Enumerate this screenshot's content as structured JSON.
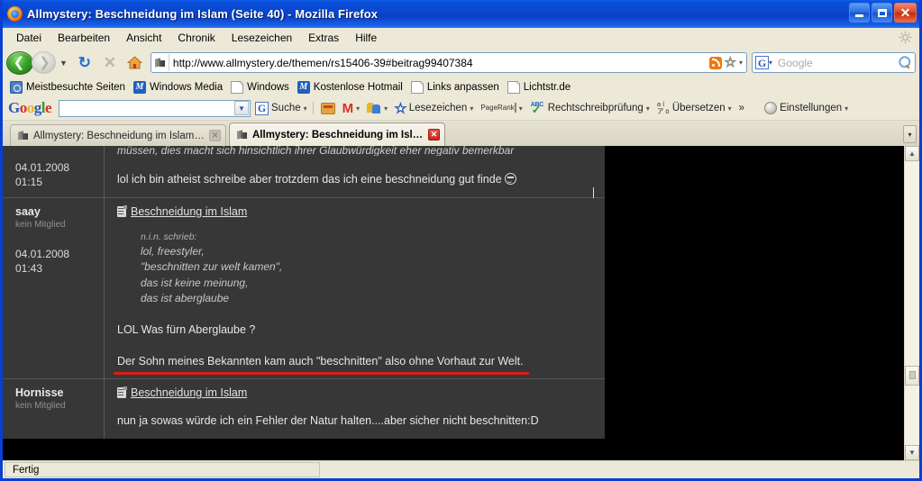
{
  "window": {
    "title": "Allmystery: Beschneidung im Islam (Seite 40) - Mozilla Firefox",
    "minimize_label": "_",
    "maximize_label": "",
    "close_label": "✕"
  },
  "menubar": {
    "items": [
      "Datei",
      "Bearbeiten",
      "Ansicht",
      "Chronik",
      "Lesezeichen",
      "Extras",
      "Hilfe"
    ]
  },
  "navbar": {
    "back_label": "❮",
    "forward_label": "❯",
    "dropdown_label": "▼",
    "reload_label": "↻",
    "stop_label": "✕",
    "home_label": "⌂",
    "url": "http://www.allmystery.de/themen/rs15406-39#beitrag99407384",
    "rss_name": "rss-icon",
    "star_label": "☆",
    "url_dropdown": "▾",
    "search_engine": "G",
    "search_placeholder": "Google",
    "search_value": "",
    "search_dropdown": "▾"
  },
  "bookmarks": [
    {
      "label": "Meistbesuchte Seiten",
      "icon": "most-visited-icon"
    },
    {
      "label": "Windows Media",
      "icon": "windows-media-icon"
    },
    {
      "label": "Windows",
      "icon": "document-icon"
    },
    {
      "label": "Kostenlose Hotmail",
      "icon": "hotmail-icon"
    },
    {
      "label": "Links anpassen",
      "icon": "document-icon"
    },
    {
      "label": "Lichtstr.de",
      "icon": "document-icon"
    }
  ],
  "google_toolbar": {
    "logo": [
      "G",
      "o",
      "o",
      "g",
      "l",
      "e"
    ],
    "search_value": "",
    "items": [
      {
        "label": "Suche",
        "icon": "google-g-icon",
        "has_dropdown": true
      },
      {
        "label": "",
        "icon": "wallet-icon",
        "has_dropdown": false
      },
      {
        "label": "",
        "icon": "gmail-icon",
        "has_dropdown": true
      },
      {
        "label": "",
        "icon": "sharing-icon",
        "has_dropdown": true
      },
      {
        "label": "Lesezeichen",
        "icon": "star-icon",
        "has_dropdown": true
      },
      {
        "label": "",
        "icon": "pagerank-icon",
        "has_dropdown": true
      },
      {
        "label": "Rechtschreibprüfung",
        "icon": "abc-check-icon",
        "has_dropdown": true
      },
      {
        "label": "Übersetzen",
        "icon": "translate-icon",
        "has_dropdown": true
      }
    ],
    "pagerank_label": "PageRank",
    "overflow_label": "»",
    "settings_label": "Einstellungen",
    "settings_dropdown": "▾"
  },
  "tabs": [
    {
      "label": "Allmystery: Beschneidung im Islam (Seit...",
      "active": false,
      "close": "✕"
    },
    {
      "label": "Allmystery: Beschneidung im Isla...",
      "active": true,
      "close": "✕"
    }
  ],
  "tab_list_all": "▾",
  "page": {
    "posts": [
      {
        "author": "",
        "rank": "",
        "date": "04.01.2008",
        "time": "01:15",
        "title": "",
        "cut_top_line": "müssen, dies macht sich hinsichtlich ihrer Glaubwürdigkeit eher negativ bemerkbar",
        "body_lines": [
          "lol ich bin atheist schreibe aber trotzdem das ich eine beschneidung gut finde"
        ],
        "has_emoji": true,
        "partial": true
      },
      {
        "author": "saay",
        "rank": "kein Mitglied",
        "date": "04.01.2008",
        "time": "01:43",
        "title": "Beschneidung im Islam",
        "quote_author": "n.i.n. schrieb:",
        "quote_lines": [
          "lol, freestyler,",
          "\"beschnitten zur welt kamen\",",
          "das ist keine meinung,",
          "das ist aberglaube"
        ],
        "body_lines": [
          "LOL Was fürn Aberglaube ?"
        ],
        "underlined_line": "Der Sohn meines Bekannten kam auch \"beschnitten\" also ohne Vorhaut zur Welt.",
        "underline_color": "#e01b16",
        "partial": false
      },
      {
        "author": "Hornisse",
        "rank": "kein Mitglied",
        "date": "",
        "time": "",
        "title": "Beschneidung im Islam",
        "body_lines": [
          "nun ja sowas würde ich ein Fehler der Natur halten....aber sicher nicht beschnitten:D"
        ],
        "partial": true
      }
    ]
  },
  "scrollbar": {
    "up_label": "▲",
    "down_label": "▼",
    "thumb_position_percent": 72
  },
  "statusbar": {
    "text": "Fertig"
  }
}
